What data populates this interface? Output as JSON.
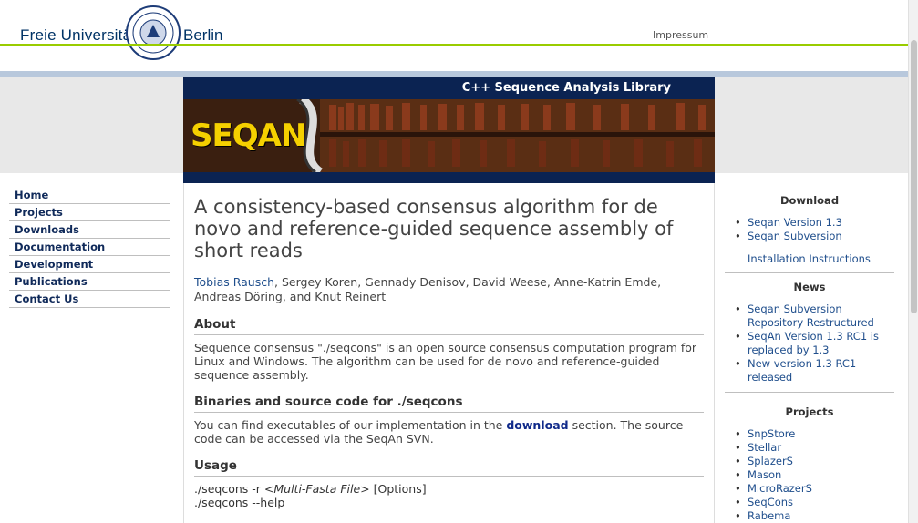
{
  "header": {
    "logo_left": "Freie Universität",
    "logo_right": "Berlin",
    "impressum": "Impressum"
  },
  "banner": {
    "caption": "C++ Sequence Analysis Library",
    "logo_text": "SEQAN"
  },
  "nav": {
    "items": [
      "Home",
      "Projects",
      "Downloads",
      "Documentation",
      "Development",
      "Publications",
      "Contact Us"
    ]
  },
  "main": {
    "title": "A consistency-based consensus algorithm for de novo and reference-guided sequence assembly of short reads",
    "author_link": "Tobias Rausch",
    "authors_rest": ", Sergey Koren, Gennady Denisov, David Weese, Anne-Katrin Emde, Andreas Döring, and Knut Reinert",
    "about_heading": "About",
    "about_text": "Sequence consensus \"./seqcons\" is an open source consensus computation program for Linux and Windows. The algorithm can be used for de novo and reference-guided sequence assembly.",
    "binaries_heading": "Binaries and source code for ./seqcons",
    "binaries_text_1": "You can find executables of our implementation in the ",
    "binaries_link": "download",
    "binaries_text_2": " section. The source code can be accessed via the SeqAn SVN.",
    "usage_heading": "Usage",
    "usage_line1_a": "./seqcons -r <",
    "usage_line1_em": "Multi-Fasta File",
    "usage_line1_b": "> [Options]",
    "usage_line2": "./seqcons --help"
  },
  "sidebar": {
    "download_heading": "Download",
    "download_items": [
      "Seqan Version 1.3",
      "Seqan Subversion"
    ],
    "install_link": "Installation Instructions",
    "news_heading": "News",
    "news_items": [
      "Seqan Subversion Repository Restructured",
      "SeqAn Version 1.3 RC1 is replaced by 1.3",
      "New version 1.3 RC1 released"
    ],
    "projects_heading": "Projects",
    "project_items": [
      "SnpStore",
      "Stellar",
      "SplazerS",
      "Mason",
      "MicroRazerS",
      "SeqCons",
      "Rabema"
    ]
  },
  "colors": {
    "green_accent": "#99cc00",
    "navy": "#102a5a",
    "link": "#1f4e8c"
  }
}
